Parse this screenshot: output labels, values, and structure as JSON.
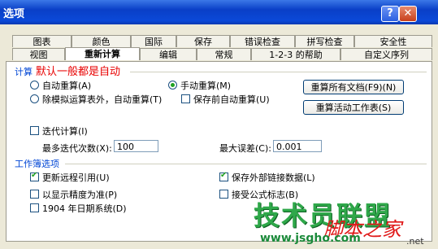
{
  "window": {
    "title": "选项",
    "help_label": "?",
    "close_label": "✕"
  },
  "tabs_row1": [
    "图表",
    "颜色",
    "国际",
    "保存",
    "错误检查",
    "拼写检查",
    "安全性"
  ],
  "tabs_row2": [
    "视图",
    "重新计算",
    "编辑",
    "常规",
    "1-2-3 的帮助",
    "自定义序列"
  ],
  "active_tab": "重新计算",
  "calc": {
    "section_label": "计算",
    "note": "默认一般都是自动",
    "auto_label": "自动重算(A)",
    "auto_except_label": "除模拟运算表外，自动重算(T)",
    "manual_label": "手动重算(M)",
    "save_before_label": "保存前自动重算(U)",
    "recalc_all_button": "重算所有文档(F9)(N)",
    "recalc_sheet_button": "重算活动工作表(S)"
  },
  "iteration": {
    "label": "迭代计算(I)",
    "max_iter_label": "最多迭代次数(X):",
    "max_iter_value": "100",
    "max_change_label": "最大误差(C):",
    "max_change_value": "0.001"
  },
  "workbook": {
    "section_label": "工作簿选项",
    "update_remote_label": "更新远程引用(U)",
    "precision_label": "以显示精度为准(P)",
    "date1904_label": "1904 年日期系统(D)",
    "save_external_label": "保存外部链接数据(L)",
    "accept_labels_label": "接受公式标志(B)"
  },
  "watermark": {
    "main": "技术员联盟",
    "side": "脚本之家",
    "url": "www.jsgho.com",
    "net": ".net"
  }
}
